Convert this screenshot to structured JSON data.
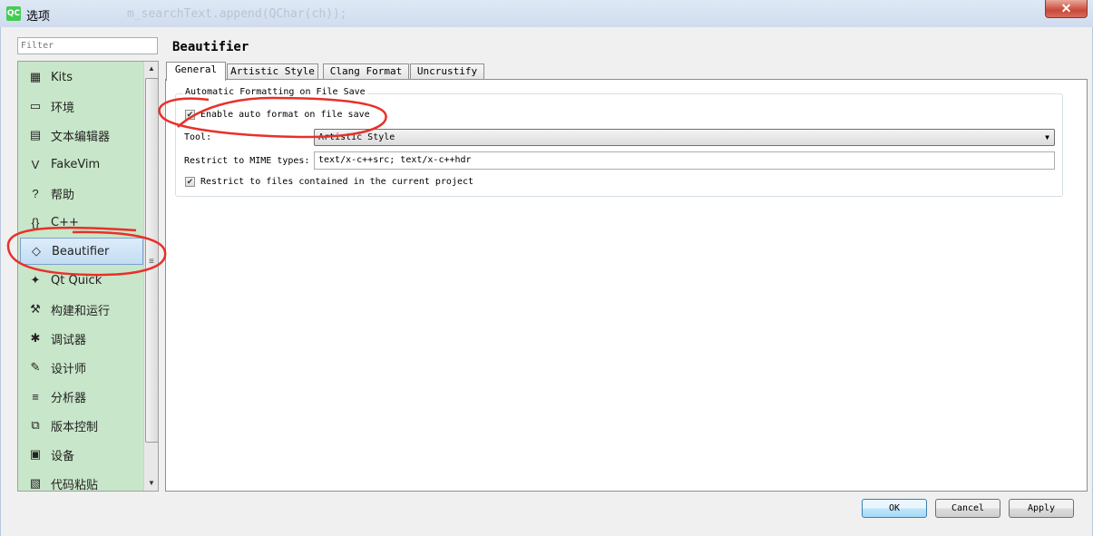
{
  "window": {
    "title": "选项",
    "ghost_text": "m_searchText.append(QChar(ch));",
    "close_label": "✕",
    "logo_text": "QC"
  },
  "sidebar": {
    "filter_placeholder": "Filter",
    "items": [
      {
        "label": "Kits",
        "icon": "kits-icon",
        "glyph": "▦"
      },
      {
        "label": "环境",
        "icon": "monitor-icon",
        "glyph": "▭"
      },
      {
        "label": "文本编辑器",
        "icon": "text-editor-icon",
        "glyph": "▤"
      },
      {
        "label": "FakeVim",
        "icon": "fakevim-icon",
        "glyph": "V"
      },
      {
        "label": "帮助",
        "icon": "help-icon",
        "glyph": "?"
      },
      {
        "label": "C++",
        "icon": "cpp-icon",
        "glyph": "{}"
      },
      {
        "label": "Beautifier",
        "icon": "diamond-icon",
        "glyph": "◇"
      },
      {
        "label": "Qt Quick",
        "icon": "qtquick-icon",
        "glyph": "✦"
      },
      {
        "label": "构建和运行",
        "icon": "hammer-icon",
        "glyph": "⚒"
      },
      {
        "label": "调试器",
        "icon": "bug-icon",
        "glyph": "✱"
      },
      {
        "label": "设计师",
        "icon": "pencil-icon",
        "glyph": "✎"
      },
      {
        "label": "分析器",
        "icon": "analyzer-icon",
        "glyph": "≡"
      },
      {
        "label": "版本控制",
        "icon": "version-control-icon",
        "glyph": "⧉"
      },
      {
        "label": "设备",
        "icon": "device-icon",
        "glyph": "▣"
      },
      {
        "label": "代码粘贴",
        "icon": "clipboard-icon",
        "glyph": "▧"
      }
    ],
    "selected": "Beautifier"
  },
  "main": {
    "page_title": "Beautifier",
    "tabs": [
      {
        "label": "General"
      },
      {
        "label": "Artistic Style"
      },
      {
        "label": "Clang Format"
      },
      {
        "label": "Uncrustify"
      }
    ],
    "active_tab": "General",
    "group": {
      "title": "Automatic Formatting on File Save",
      "enable_label": "Enable auto format on file save",
      "enable_checked": true,
      "tool_label": "Tool:",
      "tool_value": "Artistic Style",
      "mime_label": "Restrict to MIME types:",
      "mime_value": "text/x-c++src; text/x-c++hdr",
      "restrict_label": "Restrict to files contained in the current project",
      "restrict_checked": true
    }
  },
  "buttons": {
    "ok": "OK",
    "cancel": "Cancel",
    "apply": "Apply"
  },
  "colors": {
    "sidebar_bg": "#c8e6c9",
    "annotation": "#e8302a"
  }
}
